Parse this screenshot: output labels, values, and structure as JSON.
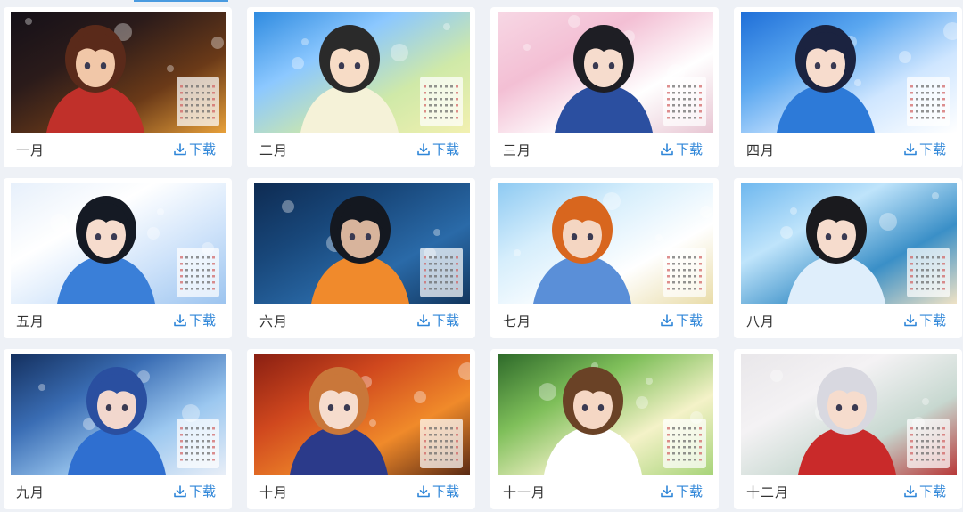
{
  "download_label": "下载",
  "cards": [
    {
      "month": "一月",
      "bg": [
        "#141018",
        "#2b1b1a",
        "#6b3a18",
        "#e8a13a"
      ],
      "accent": "#c0302a",
      "skin": "#f1c7a8",
      "hair": "#5a2a1a"
    },
    {
      "month": "二月",
      "bg": [
        "#2f8be0",
        "#8cc8ff",
        "#cfe9a8",
        "#f2f0b0"
      ],
      "accent": "#f5f2d8",
      "skin": "#f7dcc6",
      "hair": "#2a2a2a"
    },
    {
      "month": "三月",
      "bg": [
        "#f7d7e4",
        "#f3bfd4",
        "#ffffff",
        "#e8c6d3"
      ],
      "accent": "#2b4fa0",
      "skin": "#f6dccd",
      "hair": "#1e1e24"
    },
    {
      "month": "四月",
      "bg": [
        "#1f6fd8",
        "#5aa7f0",
        "#cfe6ff",
        "#ffffff"
      ],
      "accent": "#2d7ad8",
      "skin": "#f7dccd",
      "hair": "#1b2340"
    },
    {
      "month": "五月",
      "bg": [
        "#e7f0fb",
        "#ffffff",
        "#cfe3fa",
        "#9cc4ef"
      ],
      "accent": "#3a7fd8",
      "skin": "#f6dccd",
      "hair": "#151a24"
    },
    {
      "month": "六月",
      "bg": [
        "#0e2b52",
        "#18477a",
        "#2a6aa8",
        "#12365e"
      ],
      "accent": "#f08a2c",
      "skin": "#d8b49c",
      "hair": "#141820"
    },
    {
      "month": "七月",
      "bg": [
        "#8ecaf2",
        "#d6eefc",
        "#ffffff",
        "#e9dca8"
      ],
      "accent": "#5a8fd8",
      "skin": "#f4d6c2",
      "hair": "#d8661e"
    },
    {
      "month": "八月",
      "bg": [
        "#6fb8ef",
        "#bfe4fb",
        "#3a8fc7",
        "#efe2c5"
      ],
      "accent": "#dfeefb",
      "skin": "#f6dccd",
      "hair": "#1a1a1e"
    },
    {
      "month": "九月",
      "bg": [
        "#14305f",
        "#3a6db4",
        "#9cc8f0",
        "#e8eef7"
      ],
      "accent": "#2f6fd0",
      "skin": "#f2d7cd",
      "hair": "#2a4fa0"
    },
    {
      "month": "十月",
      "bg": [
        "#8a1f12",
        "#d0481e",
        "#f08a2a",
        "#5a2a14"
      ],
      "accent": "#2b3a8a",
      "skin": "#f6dccd",
      "hair": "#c9773a"
    },
    {
      "month": "十一月",
      "bg": [
        "#2e6a2a",
        "#7fbf5a",
        "#f4f2c8",
        "#a8d47a"
      ],
      "accent": "#ffffff",
      "skin": "#f5d7c4",
      "hair": "#6a4226"
    },
    {
      "month": "十二月",
      "bg": [
        "#e9e7ea",
        "#f4f2f4",
        "#c7d8d0",
        "#b83a3a"
      ],
      "accent": "#c92a2a",
      "skin": "#f6dccd",
      "hair": "#d8d8e0"
    }
  ]
}
